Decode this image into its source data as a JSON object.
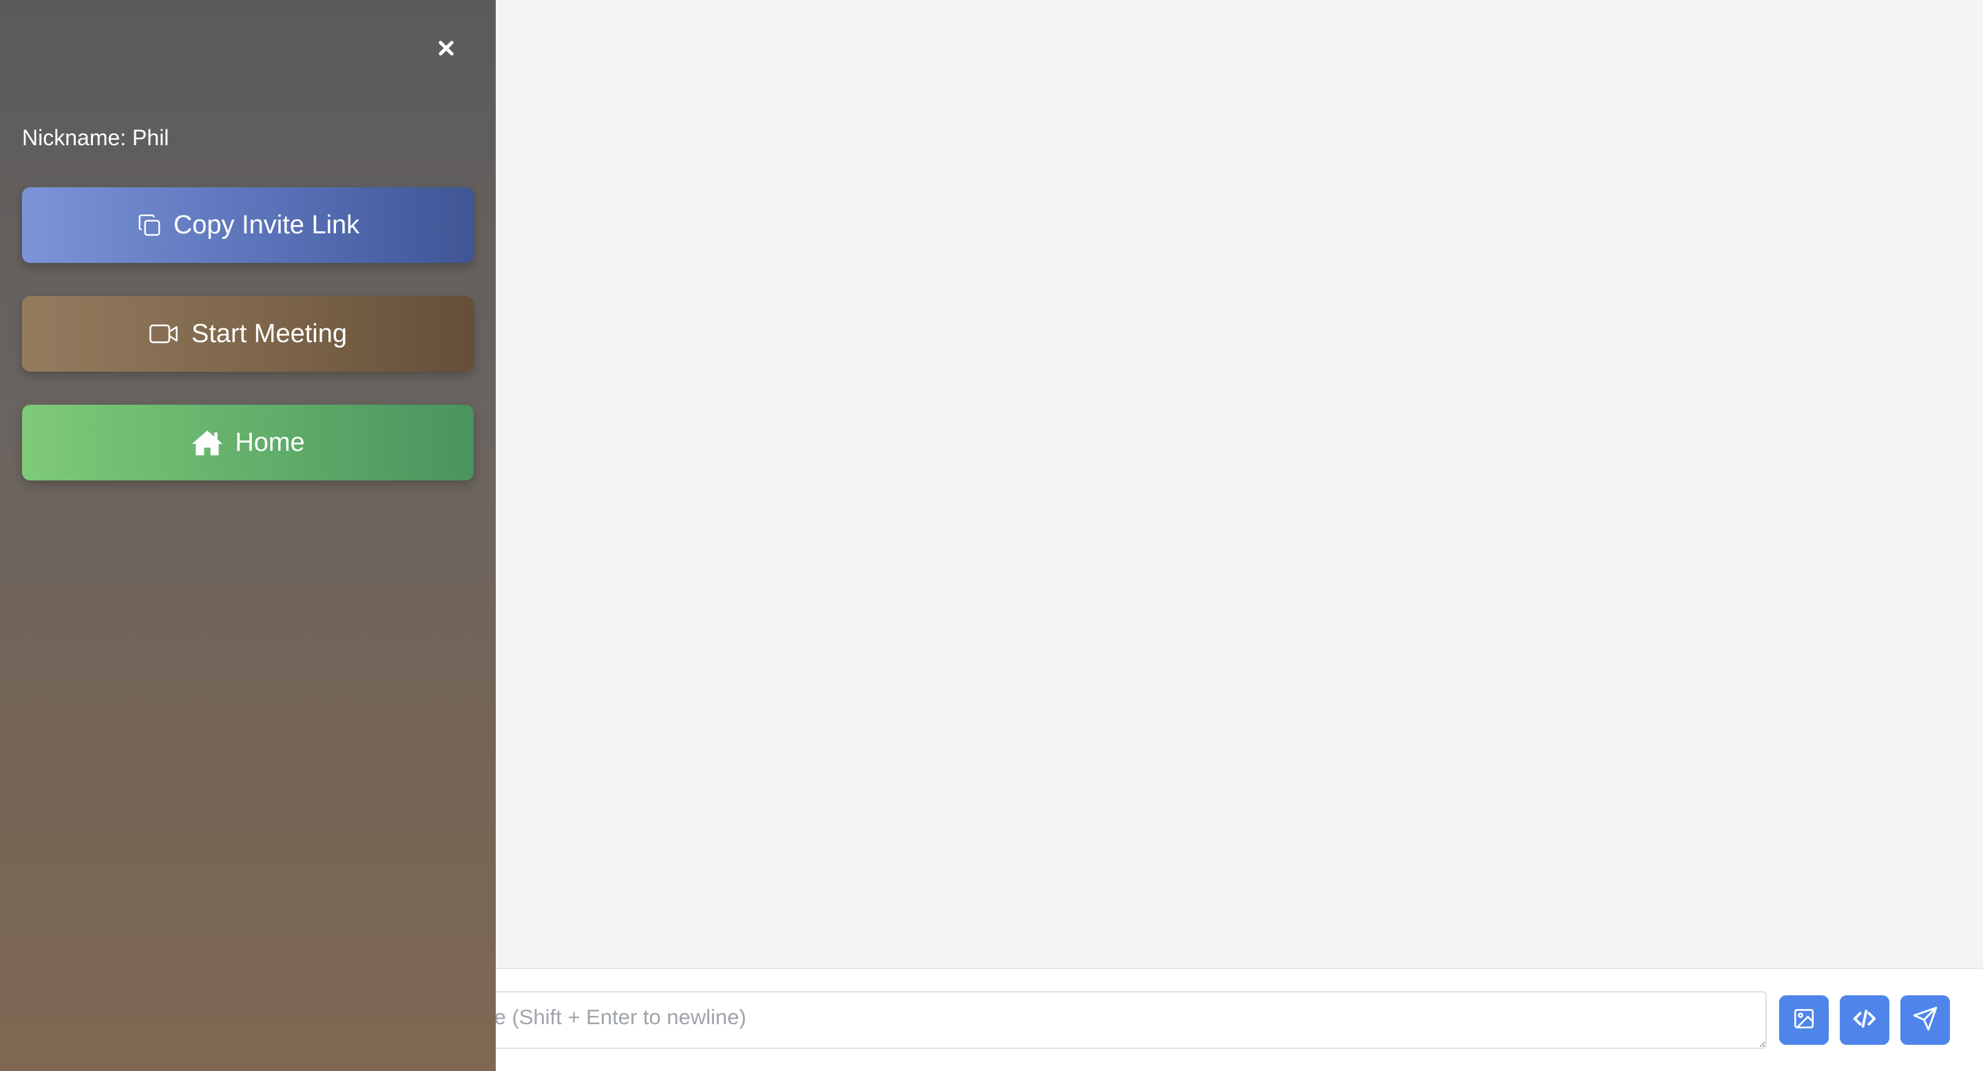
{
  "sidebar": {
    "nickname": "Nickname: Phil",
    "close_icon": "close-icon",
    "buttons": {
      "copy_invite": {
        "label": "Copy Invite Link",
        "icon": "copy-icon"
      },
      "start_meeting": {
        "label": "Start Meeting",
        "icon": "video-camera-icon"
      },
      "home": {
        "label": "Home",
        "icon": "home-icon"
      }
    }
  },
  "composer": {
    "placeholder": "wn) & Type message (Shift + Enter to newline)",
    "value": "",
    "actions": [
      {
        "name": "upload-image",
        "icon": "image-icon"
      },
      {
        "name": "code",
        "icon": "code-icon"
      },
      {
        "name": "send",
        "icon": "send-icon"
      }
    ]
  },
  "colors": {
    "accent": "#4f85ea",
    "copy_button": "#5a72b8",
    "meeting_button": "#7c654a",
    "home_button": "#61ad6a",
    "main_background": "#f3f4f6"
  }
}
